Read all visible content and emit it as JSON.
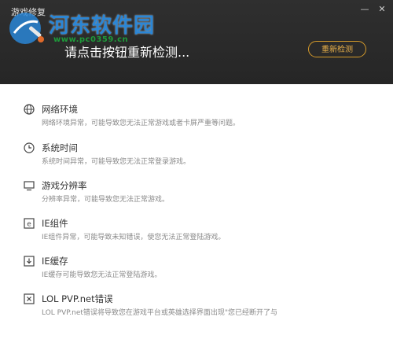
{
  "window": {
    "title": "游戏修复",
    "minimize_glyph": "—",
    "close_glyph": "✕"
  },
  "watermark": {
    "name": "河东软件园",
    "url": "www.pc0359.cn"
  },
  "header": {
    "status_text": "请点击按钮重新检测...",
    "recheck_label": "重新检测",
    "accent_color": "#d49a2a"
  },
  "items": [
    {
      "icon": "globe-icon",
      "title": "网络环境",
      "desc": "网络环境异常，可能导致您无法正常游戏或者卡屏严重等问题。"
    },
    {
      "icon": "clock-icon",
      "title": "系统时间",
      "desc": "系统时间异常，可能导致您无法正常登录游戏。"
    },
    {
      "icon": "monitor-icon",
      "title": "游戏分辨率",
      "desc": "分辨率异常，可能导致您无法正常游戏。"
    },
    {
      "icon": "ie-icon",
      "title": "IE组件",
      "desc": "IE组件异常，可能导致未知错误，使您无法正常登陆游戏。"
    },
    {
      "icon": "download-icon",
      "title": "IE缓存",
      "desc": "IE缓存可能导致您无法正常登陆游戏。"
    },
    {
      "icon": "x-box-icon",
      "title": "LOL PVP.net错误",
      "desc": "LOL PVP.net错误将导致您在游戏平台或英雄选择界面出现\"您已经断开了与"
    }
  ]
}
